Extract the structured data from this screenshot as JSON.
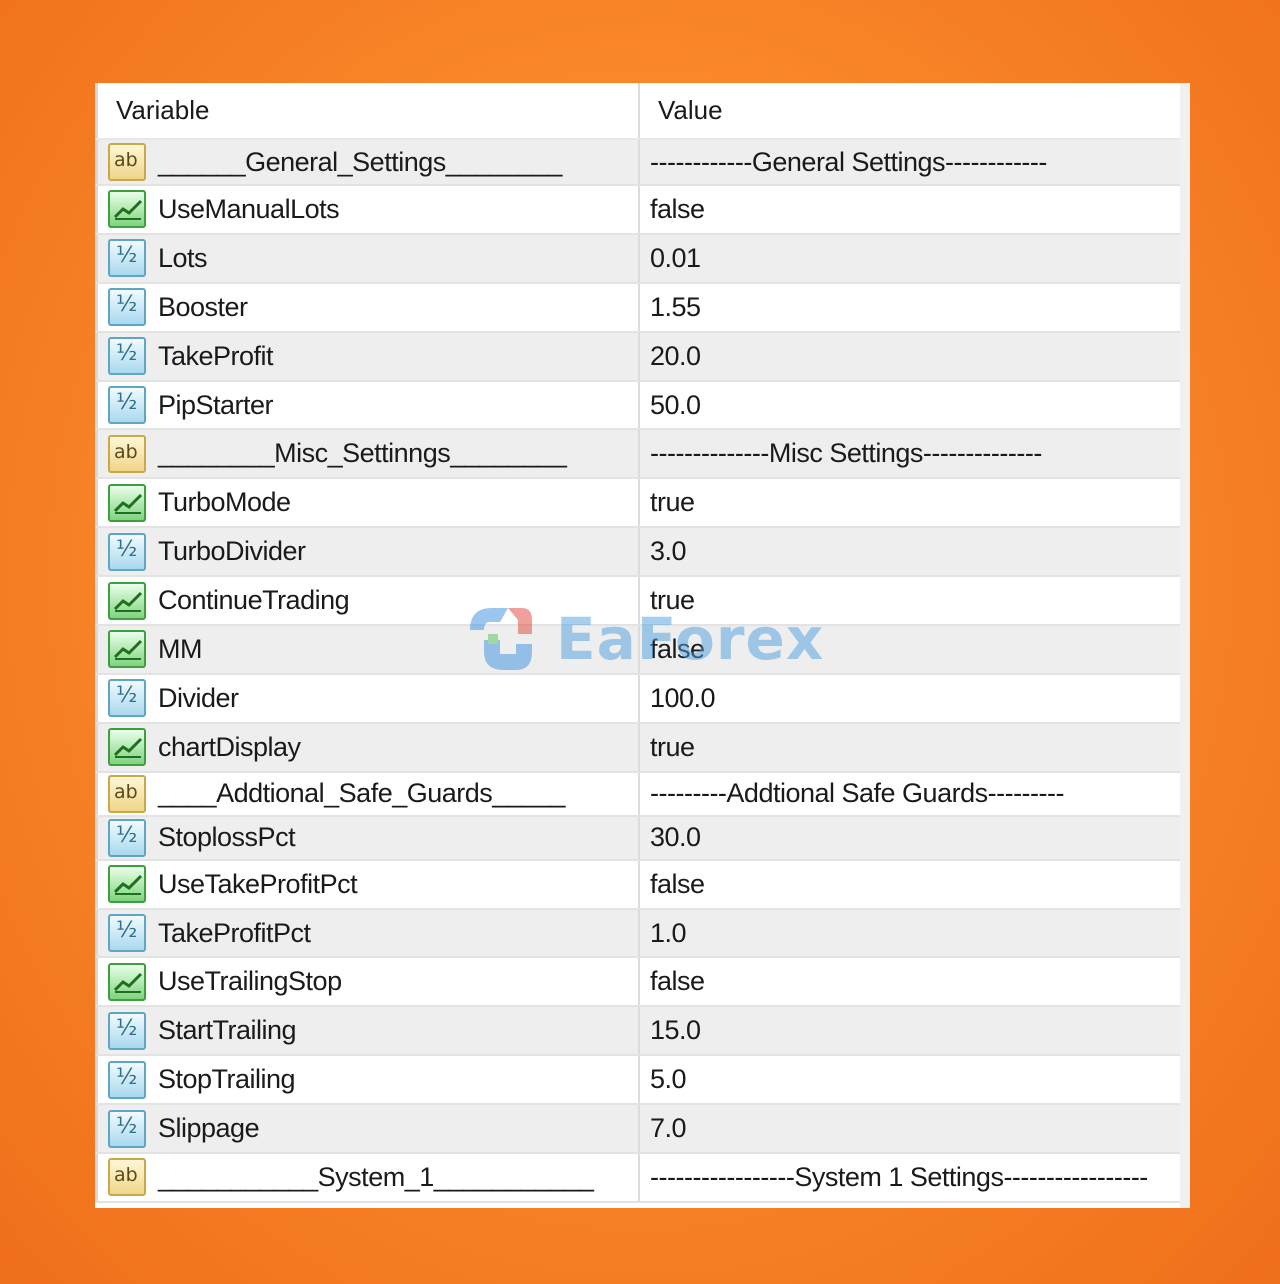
{
  "table": {
    "header": {
      "variable": "Variable",
      "value": "Value"
    },
    "rows": [
      {
        "type": "string",
        "icon": "string-ab-icon",
        "name": "______General_Settings________",
        "value": "------------General Settings------------"
      },
      {
        "type": "bool",
        "icon": "boolean-icon",
        "name": "UseManualLots",
        "value": "false"
      },
      {
        "type": "number",
        "icon": "number-icon",
        "name": "Lots",
        "value": "0.01"
      },
      {
        "type": "number",
        "icon": "number-icon",
        "name": "Booster",
        "value": "1.55"
      },
      {
        "type": "number",
        "icon": "number-icon",
        "name": "TakeProfit",
        "value": "20.0"
      },
      {
        "type": "number",
        "icon": "number-icon",
        "name": "PipStarter",
        "value": "50.0"
      },
      {
        "type": "string",
        "icon": "string-ab-icon",
        "name": "________Misc_Settinngs________",
        "value": "--------------Misc Settings--------------"
      },
      {
        "type": "bool",
        "icon": "boolean-icon",
        "name": "TurboMode",
        "value": "true"
      },
      {
        "type": "number",
        "icon": "number-icon",
        "name": "TurboDivider",
        "value": "3.0"
      },
      {
        "type": "bool",
        "icon": "boolean-icon",
        "name": "ContinueTrading",
        "value": "true"
      },
      {
        "type": "bool",
        "icon": "boolean-icon",
        "name": "MM",
        "value": "false"
      },
      {
        "type": "number",
        "icon": "number-icon",
        "name": "Divider",
        "value": "100.0"
      },
      {
        "type": "bool",
        "icon": "boolean-icon",
        "name": "chartDisplay",
        "value": "true"
      },
      {
        "type": "string",
        "icon": "string-ab-icon",
        "name": "____Addtional_Safe_Guards_____",
        "value": "---------Addtional Safe Guards---------"
      },
      {
        "type": "number",
        "icon": "number-icon",
        "name": "StoplossPct",
        "value": "30.0"
      },
      {
        "type": "bool",
        "icon": "boolean-icon",
        "name": "UseTakeProfitPct",
        "value": "false"
      },
      {
        "type": "number",
        "icon": "number-icon",
        "name": "TakeProfitPct",
        "value": "1.0"
      },
      {
        "type": "bool",
        "icon": "boolean-icon",
        "name": "UseTrailingStop",
        "value": "false"
      },
      {
        "type": "number",
        "icon": "number-icon",
        "name": "StartTrailing",
        "value": "15.0"
      },
      {
        "type": "number",
        "icon": "number-icon",
        "name": "StopTrailing",
        "value": "5.0"
      },
      {
        "type": "number",
        "icon": "number-icon",
        "name": "Slippage",
        "value": "7.0"
      },
      {
        "type": "string",
        "icon": "string-ab-icon",
        "name": "___________System_1___________",
        "value": "-----------------System 1 Settings-----------------"
      }
    ]
  },
  "watermark": {
    "text": "EaForex"
  },
  "colors": {
    "background": "#fb8a2b",
    "row_alt": "#eeeeee",
    "bool_icon": "#7fd47f",
    "number_icon": "#a9d9ee",
    "string_icon": "#efd68a"
  }
}
